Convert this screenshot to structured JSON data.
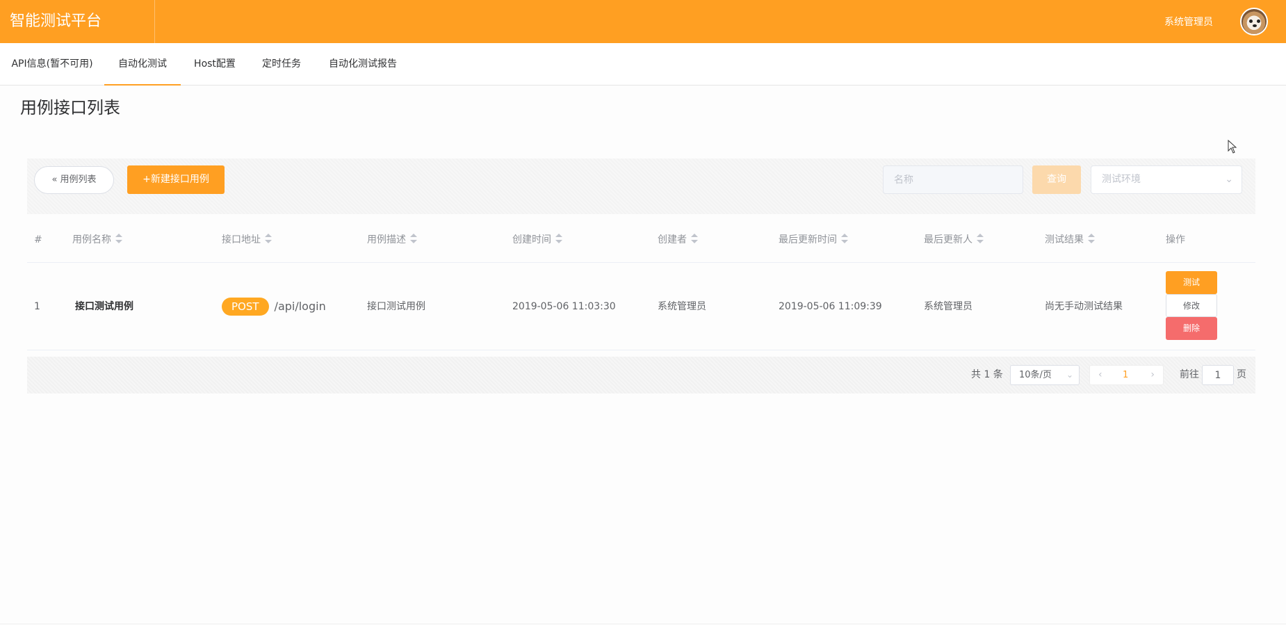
{
  "header": {
    "app_title": "智能测试平台",
    "user_name": "系统管理员",
    "brand_color": "#ff9f22"
  },
  "nav": {
    "items": [
      {
        "label": "API信息(暂不可用)"
      },
      {
        "label": "自动化测试",
        "active": true
      },
      {
        "label": "Host配置"
      },
      {
        "label": "定时任务"
      },
      {
        "label": "自动化测试报告"
      }
    ]
  },
  "page": {
    "title": "用例接口列表"
  },
  "toolbar": {
    "back_label": "用例列表",
    "back_icon": "double-chevron-left-icon",
    "new_label": "+新建接口用例",
    "name_placeholder": "名称",
    "query_label": "查询",
    "env_placeholder": "测试环境"
  },
  "table": {
    "columns": [
      "#",
      "用例名称",
      "接口地址",
      "用例描述",
      "创建时间",
      "创建者",
      "最后更新时间",
      "最后更新人",
      "测试结果",
      "操作"
    ],
    "rows": [
      {
        "index": "1",
        "name": "接口测试用例",
        "method": "POST",
        "url": "/api/login",
        "description": "接口测试用例",
        "created_at": "2019-05-06 11:03:30",
        "creator": "系统管理员",
        "updated_at": "2019-05-06 11:09:39",
        "updater": "系统管理员",
        "result": "尚无手动测试结果",
        "actions": {
          "test": "测试",
          "edit": "修改",
          "delete": "删除"
        }
      }
    ]
  },
  "pagination": {
    "total_text": "共 1 条",
    "page_size": "10条/页",
    "current_page": "1",
    "goto_label": "前往",
    "goto_value": "1",
    "goto_suffix": "页"
  }
}
